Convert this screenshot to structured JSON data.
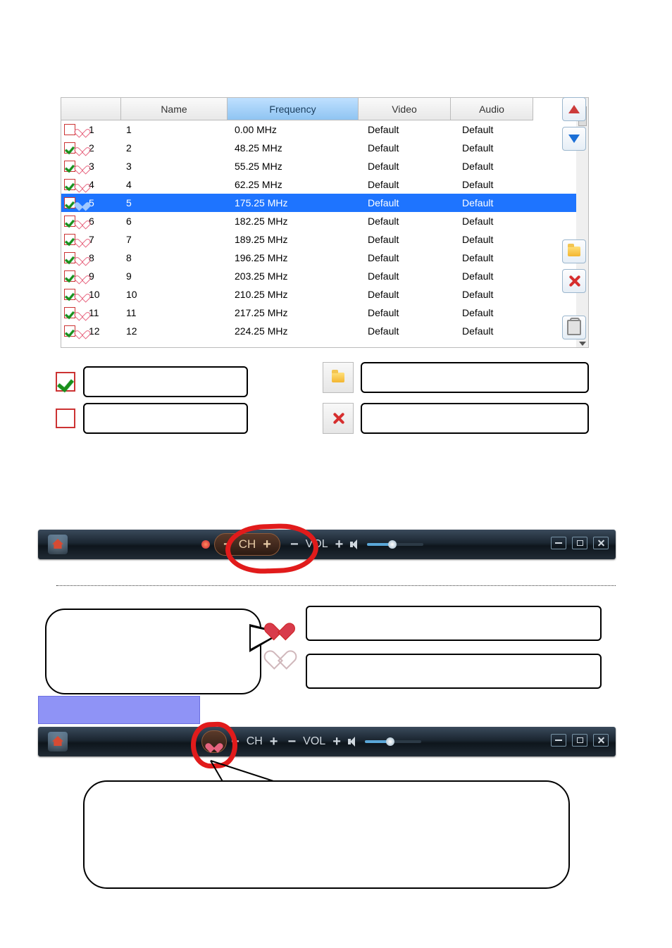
{
  "chart_data": {
    "type": "table",
    "columns": [
      "Name",
      "Frequency",
      "Video",
      "Audio"
    ],
    "rows": [
      [
        "1",
        "0.00 MHz",
        "Default",
        "Default"
      ],
      [
        "2",
        "48.25 MHz",
        "Default",
        "Default"
      ],
      [
        "3",
        "55.25 MHz",
        "Default",
        "Default"
      ],
      [
        "4",
        "62.25 MHz",
        "Default",
        "Default"
      ],
      [
        "5",
        "175.25 MHz",
        "Default",
        "Default"
      ],
      [
        "6",
        "182.25 MHz",
        "Default",
        "Default"
      ],
      [
        "7",
        "189.25 MHz",
        "Default",
        "Default"
      ],
      [
        "8",
        "196.25 MHz",
        "Default",
        "Default"
      ],
      [
        "9",
        "203.25 MHz",
        "Default",
        "Default"
      ],
      [
        "10",
        "210.25 MHz",
        "Default",
        "Default"
      ],
      [
        "11",
        "217.25 MHz",
        "Default",
        "Default"
      ],
      [
        "12",
        "224.25 MHz",
        "Default",
        "Default"
      ]
    ],
    "selected_row_index": 4,
    "sorted_column": "Frequency"
  },
  "table": {
    "headers": {
      "c0": "",
      "name": "Name",
      "freq": "Frequency",
      "video": "Video",
      "audio": "Audio"
    },
    "rows": [
      {
        "n": "1",
        "checked": false,
        "fav": false,
        "name": "1",
        "freq": "0.00 MHz",
        "video": "Default",
        "audio": "Default",
        "selected": false
      },
      {
        "n": "2",
        "checked": true,
        "fav": false,
        "name": "2",
        "freq": "48.25 MHz",
        "video": "Default",
        "audio": "Default",
        "selected": false
      },
      {
        "n": "3",
        "checked": true,
        "fav": false,
        "name": "3",
        "freq": "55.25 MHz",
        "video": "Default",
        "audio": "Default",
        "selected": false
      },
      {
        "n": "4",
        "checked": true,
        "fav": false,
        "name": "4",
        "freq": "62.25 MHz",
        "video": "Default",
        "audio": "Default",
        "selected": false
      },
      {
        "n": "5",
        "checked": true,
        "fav": true,
        "name": "5",
        "freq": "175.25 MHz",
        "video": "Default",
        "audio": "Default",
        "selected": true
      },
      {
        "n": "6",
        "checked": true,
        "fav": false,
        "name": "6",
        "freq": "182.25 MHz",
        "video": "Default",
        "audio": "Default",
        "selected": false
      },
      {
        "n": "7",
        "checked": true,
        "fav": false,
        "name": "7",
        "freq": "189.25 MHz",
        "video": "Default",
        "audio": "Default",
        "selected": false
      },
      {
        "n": "8",
        "checked": true,
        "fav": false,
        "name": "8",
        "freq": "196.25 MHz",
        "video": "Default",
        "audio": "Default",
        "selected": false
      },
      {
        "n": "9",
        "checked": true,
        "fav": false,
        "name": "9",
        "freq": "203.25 MHz",
        "video": "Default",
        "audio": "Default",
        "selected": false
      },
      {
        "n": "10",
        "checked": true,
        "fav": false,
        "name": "10",
        "freq": "210.25 MHz",
        "video": "Default",
        "audio": "Default",
        "selected": false
      },
      {
        "n": "11",
        "checked": true,
        "fav": false,
        "name": "11",
        "freq": "217.25 MHz",
        "video": "Default",
        "audio": "Default",
        "selected": false
      },
      {
        "n": "12",
        "checked": true,
        "fav": false,
        "name": "12",
        "freq": "224.25 MHz",
        "video": "Default",
        "audio": "Default",
        "selected": false
      }
    ]
  },
  "playerbar": {
    "ch_label": "CH",
    "vol_label": "VOL",
    "minus": "−",
    "plus": "+"
  }
}
